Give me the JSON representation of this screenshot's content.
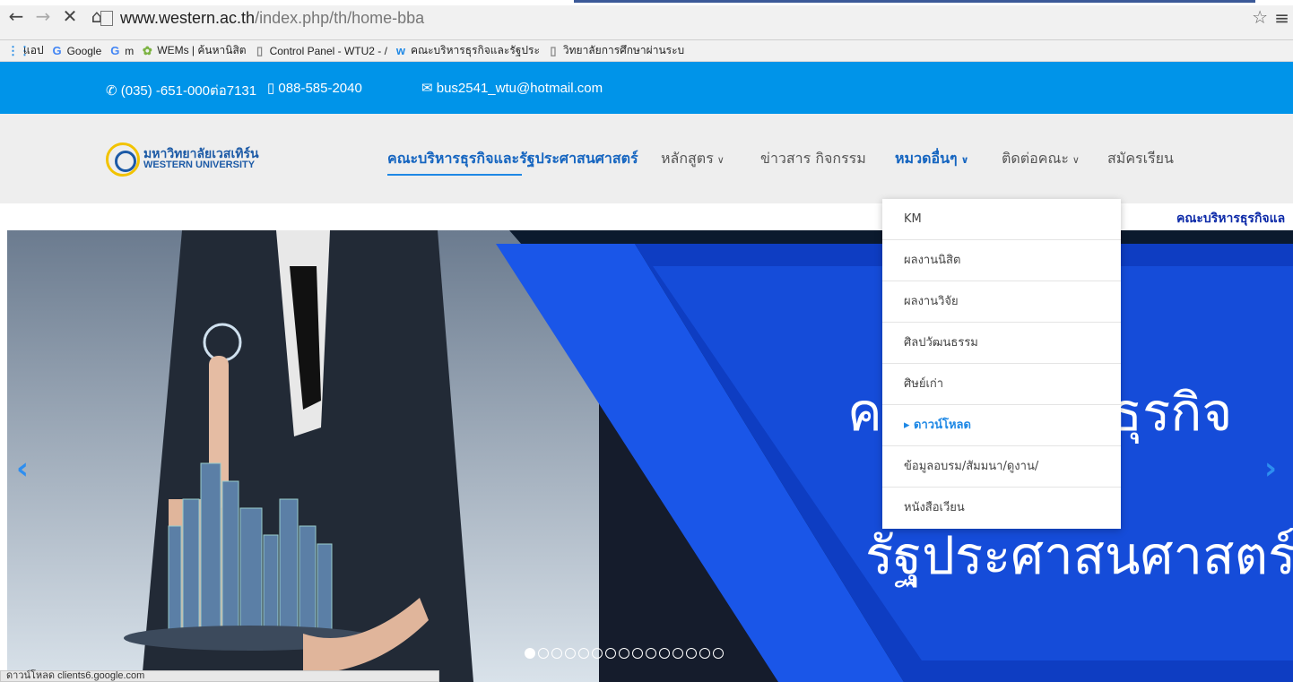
{
  "browser": {
    "url_domain": "www.western.ac.th",
    "url_path": "/index.php/th/home-bba",
    "nav": [
      "←",
      "→",
      "✕",
      "⌂"
    ]
  },
  "bookmarks": [
    {
      "label": "แอป",
      "icon": "apps-icon"
    },
    {
      "label": "Google",
      "icon": "google-icon"
    },
    {
      "label": "m",
      "icon": "google-icon"
    },
    {
      "label": "WEMs | ค้นหานิสิต",
      "icon": "wems-icon"
    },
    {
      "label": "Control Panel - WTU2 - /",
      "icon": "page-icon"
    },
    {
      "label": "คณะบริหารธุรกิจและรัฐประ",
      "icon": "wtu-icon"
    },
    {
      "label": "วิทยาลัยการศึกษาผ่านระบ",
      "icon": "page-icon"
    }
  ],
  "topbar": {
    "phone": "(035) -651-000ต่อ7131",
    "mobile": "088-585-2040",
    "email": "bus2541_wtu@hotmail.com"
  },
  "logo": {
    "line1": "มหาวิทยาลัยเวสเทิร์น",
    "line2": "WESTERN UNIVERSITY"
  },
  "menu": {
    "faculty": "คณะบริหารธุรกิจและรัฐประศาสนศาสตร์",
    "courses": "หลักสูตร",
    "news": "ข่าวสาร กิจกรรม",
    "other": "หมวดอื่นๆ",
    "contact": "ติดต่อคณะ",
    "apply": "สมัครเรียน"
  },
  "ticker": "คณะบริหารธุรกิจแล",
  "dropdown": [
    "KM",
    "ผลงานนิสิต",
    "ผลงานวิจัย",
    "ศิลปวัฒนธรรม",
    "ศิษย์เก่า",
    "ดาวน์โหลด",
    "ข้อมูลอบรม/สัมมนา/ดูงาน/",
    "หนังสือเวียน"
  ],
  "dropdown_active": "ดาวน์โหลด",
  "slide": {
    "line1": "คณะบริหารธุรกิจ",
    "line2": "รัฐประศาสนศาสตร์"
  },
  "slider_dots": 15,
  "status": "ดาวน์โหลด clients6.google.com",
  "colors": {
    "topbar": "#0094e9",
    "menu_active": "#1565c0",
    "ticker": "#0d2aa8",
    "slide_blue": "#1a56e8"
  }
}
